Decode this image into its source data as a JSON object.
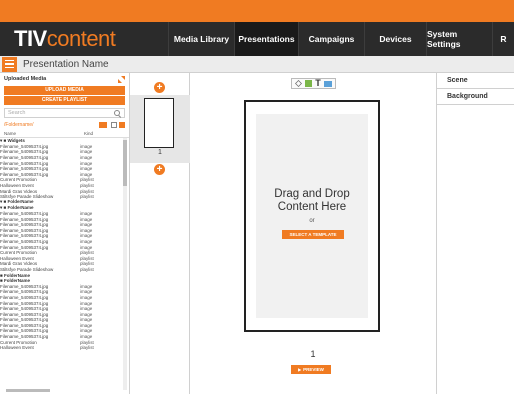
{
  "brand": {
    "logo_tiv": "TIV",
    "logo_content": "content"
  },
  "nav": {
    "items": [
      {
        "label": "Media Library",
        "active": false
      },
      {
        "label": "Presentations",
        "active": true
      },
      {
        "label": "Campaigns",
        "active": false
      },
      {
        "label": "Devices",
        "active": false
      },
      {
        "label": "System Settings",
        "active": false
      },
      {
        "label": "R",
        "active": false
      }
    ]
  },
  "page": {
    "title": "Presentation Name"
  },
  "media_panel": {
    "title": "Uploaded Media",
    "upload_label": "UPLOAD MEDIA",
    "playlist_label": "CREATE PLAYLIST",
    "search_placeholder": "Search",
    "path": "/Foldername/",
    "columns": {
      "name": "Name",
      "kind": "Kind"
    },
    "items": [
      {
        "name": "▾ ■ Widgets",
        "kind": "",
        "folder": true
      },
      {
        "name": "Filename_54095374.jpg",
        "kind": "image"
      },
      {
        "name": "Filename_54095374.jpg",
        "kind": "image"
      },
      {
        "name": "Filename_54095374.jpg",
        "kind": "image"
      },
      {
        "name": "Filename_54095374.jpg",
        "kind": "image"
      },
      {
        "name": "Filename_54095374.jpg",
        "kind": "image"
      },
      {
        "name": "Filename_54095374.jpg",
        "kind": "image"
      },
      {
        "name": "Current Promotion",
        "kind": "playlist"
      },
      {
        "name": "Halloween Event",
        "kind": "playlist"
      },
      {
        "name": "Mardi Gras Videos",
        "kind": "playlist"
      },
      {
        "name": "Stiltsfye Parade Slideshow",
        "kind": "playlist"
      },
      {
        "name": "▾ ■ FolderName",
        "kind": "",
        "folder": true
      },
      {
        "name": "▾ ■ FolderName",
        "kind": "",
        "folder": true
      },
      {
        "name": "Filename_54095374.jpg",
        "kind": "image"
      },
      {
        "name": "Filename_54095374.jpg",
        "kind": "image"
      },
      {
        "name": "Filename_54095374.jpg",
        "kind": "image"
      },
      {
        "name": "Filename_54095374.jpg",
        "kind": "image"
      },
      {
        "name": "Filename_54095374.jpg",
        "kind": "image"
      },
      {
        "name": "Filename_54095374.jpg",
        "kind": "image"
      },
      {
        "name": "Filename_54095374.jpg",
        "kind": "image"
      },
      {
        "name": "Current Promotion",
        "kind": "playlist"
      },
      {
        "name": "Halloween Event",
        "kind": "playlist"
      },
      {
        "name": "Mardi Gras Videos",
        "kind": "playlist"
      },
      {
        "name": "Stiltsfye Parade Slideshow",
        "kind": "playlist"
      },
      {
        "name": "■ FolderName",
        "kind": "",
        "folder": true
      },
      {
        "name": "■ FolderName",
        "kind": "",
        "folder": true
      },
      {
        "name": "Filename_54095374.jpg",
        "kind": "image"
      },
      {
        "name": "Filename_54095374.jpg",
        "kind": "image"
      },
      {
        "name": "Filename_54095374.jpg",
        "kind": "image"
      },
      {
        "name": "Filename_54095374.jpg",
        "kind": "image"
      },
      {
        "name": "Filename_54095374.jpg",
        "kind": "image"
      },
      {
        "name": "Filename_54095374.jpg",
        "kind": "image"
      },
      {
        "name": "Filename_54095374.jpg",
        "kind": "image"
      },
      {
        "name": "Filename_54095374.jpg",
        "kind": "image"
      },
      {
        "name": "Filename_54095374.jpg",
        "kind": "image"
      },
      {
        "name": "Filename_54095374.jpg",
        "kind": "image"
      },
      {
        "name": "Current Promotion",
        "kind": "playlist"
      },
      {
        "name": "Halloween Event",
        "kind": "playlist"
      }
    ]
  },
  "scenes": {
    "thumb_number": "1"
  },
  "canvas": {
    "drop_text": "Drag and Drop Content Here",
    "or_text": "or",
    "template_label": "SELECT A TEMPLATE",
    "page_number": "1",
    "preview_label": "PREVIEW"
  },
  "properties": {
    "scene_label": "Scene",
    "background_label": "Background"
  },
  "colors": {
    "accent": "#f07b22",
    "nav_bg": "#2b2b2b",
    "nav_active": "#1a1a1a"
  }
}
